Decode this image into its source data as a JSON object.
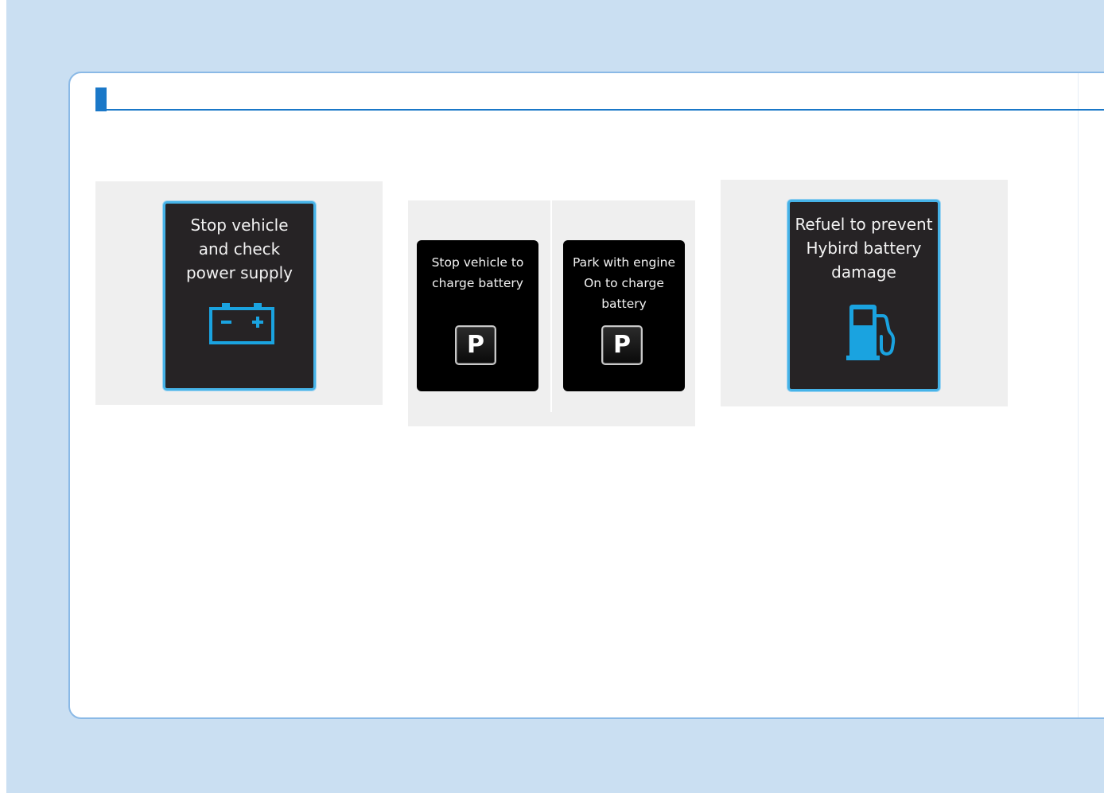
{
  "colors": {
    "page_background": "#cadff2",
    "card_border": "#8ab9e6",
    "section_accent": "#1a78c8",
    "screen_glow": "#46b3e8",
    "icon_blue": "#1aa3e0"
  },
  "figures": [
    {
      "message": "Stop vehicle\nand check\npower supply",
      "icon": "battery-icon"
    },
    {
      "screens": [
        {
          "message": "Stop vehicle to\ncharge battery",
          "icon_text": "P",
          "icon": "park-p-icon"
        },
        {
          "message": "Park with engine\nOn to charge\nbattery",
          "icon_text": "P",
          "icon": "park-p-icon"
        }
      ]
    },
    {
      "message": "Refuel to prevent\nHybird battery\ndamage",
      "icon": "fuel-pump-icon"
    }
  ]
}
